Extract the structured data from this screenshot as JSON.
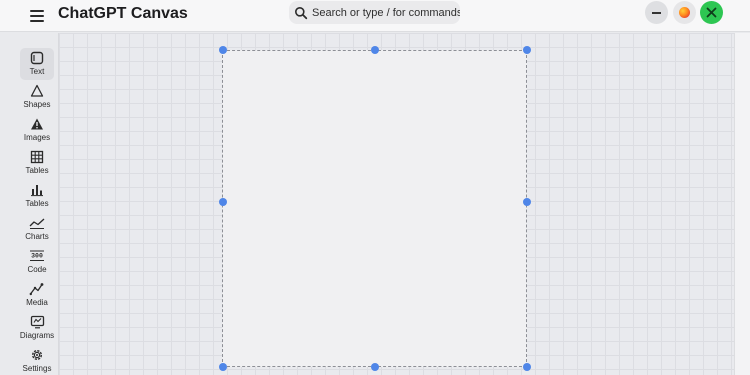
{
  "app": {
    "title": "ChatGPT Canvas"
  },
  "search": {
    "placeholder": "Search or type / for commands"
  },
  "toolbar": {
    "tools": [
      {
        "label": "Text",
        "icon": "text-box-icon",
        "active": true
      },
      {
        "label": "Shapes",
        "icon": "shapes-icon"
      },
      {
        "label": "Images",
        "icon": "image-icon"
      },
      {
        "label": "Tables",
        "icon": "table-grid-icon"
      },
      {
        "label": "Tables",
        "icon": "bar-chart-icon"
      },
      {
        "label": "Charts",
        "icon": "line-chart-icon"
      },
      {
        "label": "Code",
        "icon": "code-icon"
      },
      {
        "label": "Media",
        "icon": "media-icon"
      },
      {
        "label": "Diagrams",
        "icon": "diagram-icon"
      },
      {
        "label": "Settings",
        "icon": "gear-icon"
      }
    ]
  },
  "colors": {
    "accent_handle": "#4f86e8",
    "close_button": "#2dc652",
    "canvas_bg": "#e9eaee",
    "page_bg": "#f0f0f2"
  }
}
